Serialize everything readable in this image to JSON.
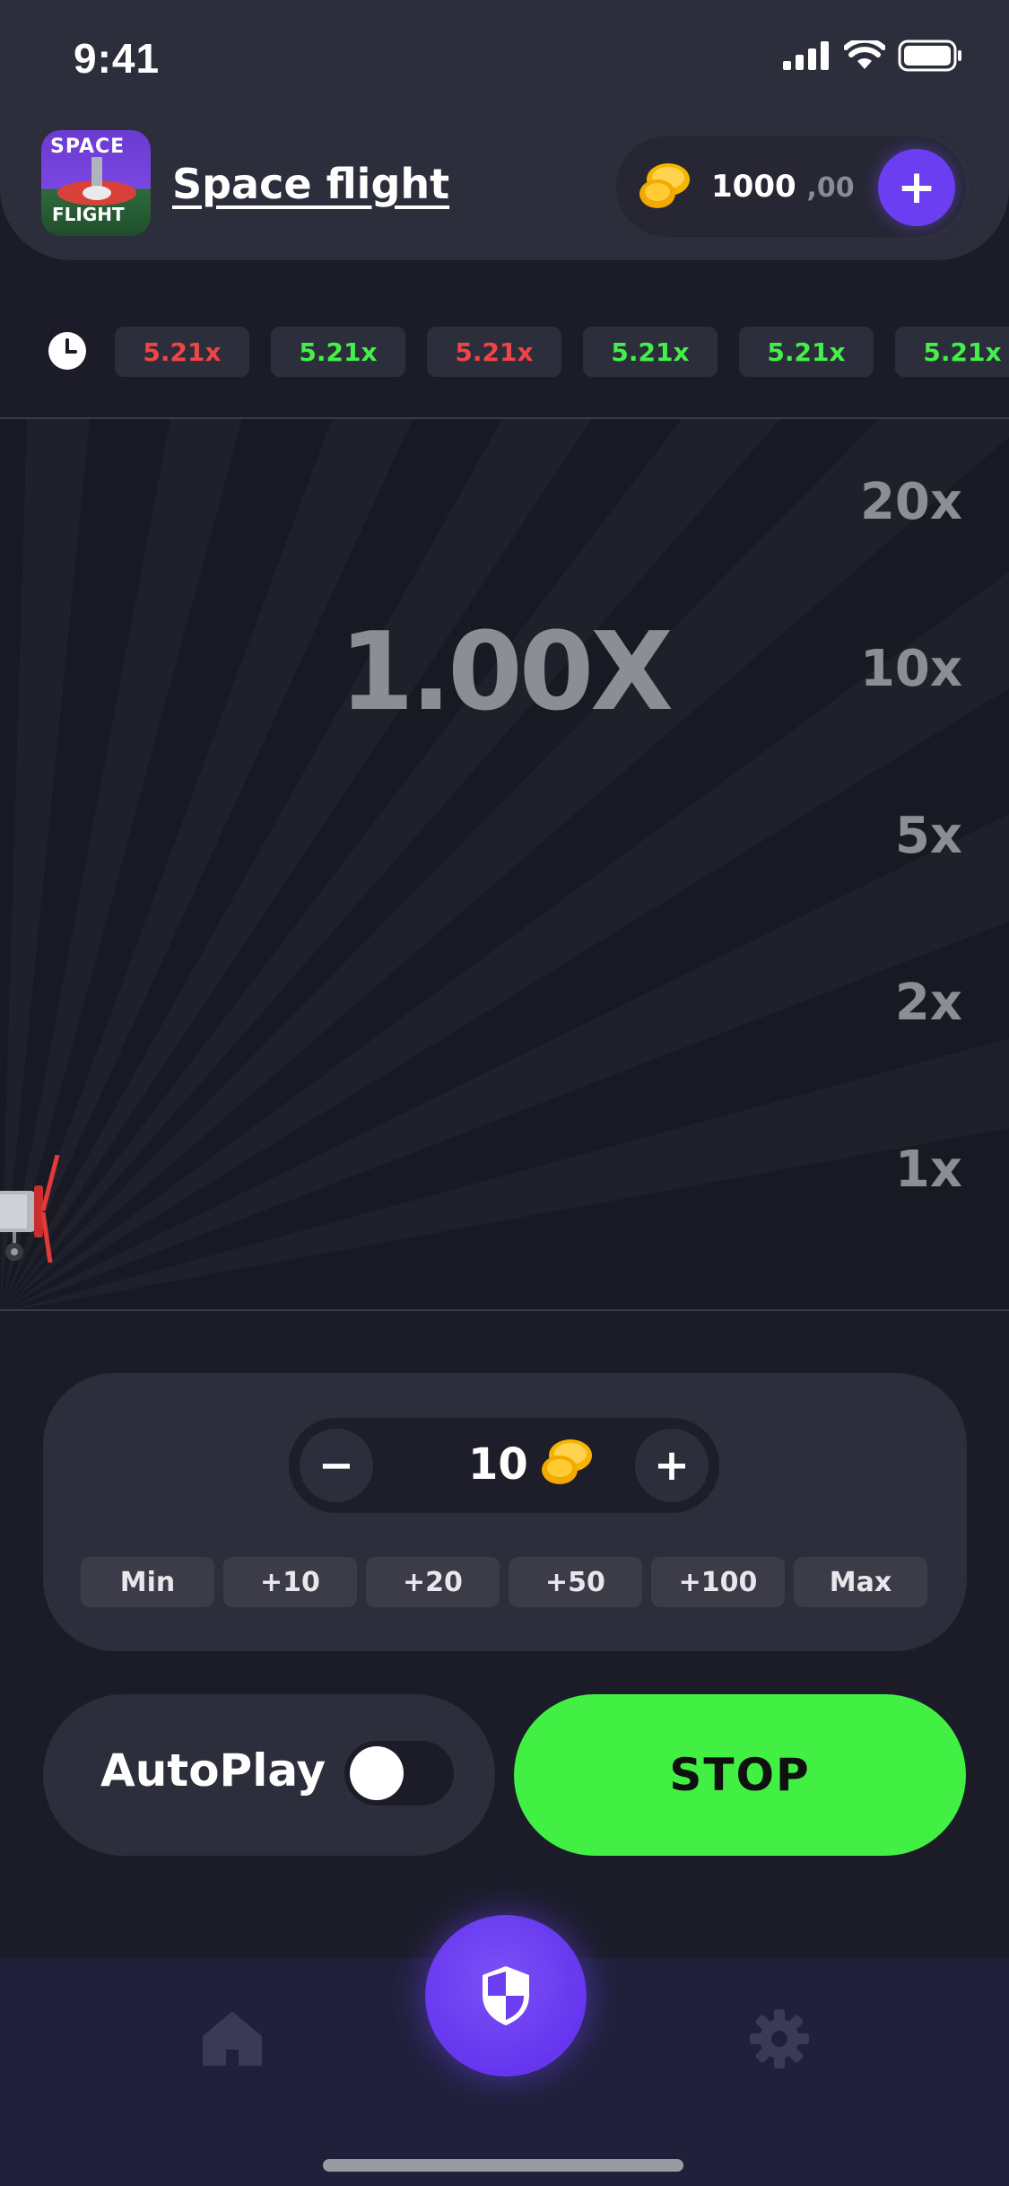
{
  "status_bar": {
    "time": "9:41"
  },
  "header": {
    "logo_text_top": "SPACE",
    "logo_text_bottom": "FLIGHT",
    "title": "Space flight",
    "balance_whole": "1000",
    "balance_decimal": ",00",
    "add_label": "+"
  },
  "history": {
    "icon": "clock-icon",
    "items": [
      {
        "value": "5.21x",
        "color": "#f04545"
      },
      {
        "value": "5.21x",
        "color": "#43f04a"
      },
      {
        "value": "5.21x",
        "color": "#f04545"
      },
      {
        "value": "5.21x",
        "color": "#43f04a"
      },
      {
        "value": "5.21x",
        "color": "#43f04a"
      },
      {
        "value": "5.21x",
        "color": "#43f04a"
      }
    ]
  },
  "game": {
    "multiplier": "1.00X",
    "scale": [
      "20x",
      "10x",
      "5x",
      "2x",
      "1x"
    ]
  },
  "bet": {
    "minus_label": "−",
    "plus_label": "+",
    "amount": "10",
    "quick": [
      "Min",
      "+10",
      "+20",
      "+50",
      "+100",
      "Max"
    ]
  },
  "controls": {
    "autoplay_label": "AutoPlay",
    "autoplay_on": false,
    "stop_label": "STOP"
  },
  "colors": {
    "accent": "#6b3ef2",
    "stop_green": "#42f044",
    "loss_red": "#f04545",
    "win_green": "#43f04a"
  }
}
